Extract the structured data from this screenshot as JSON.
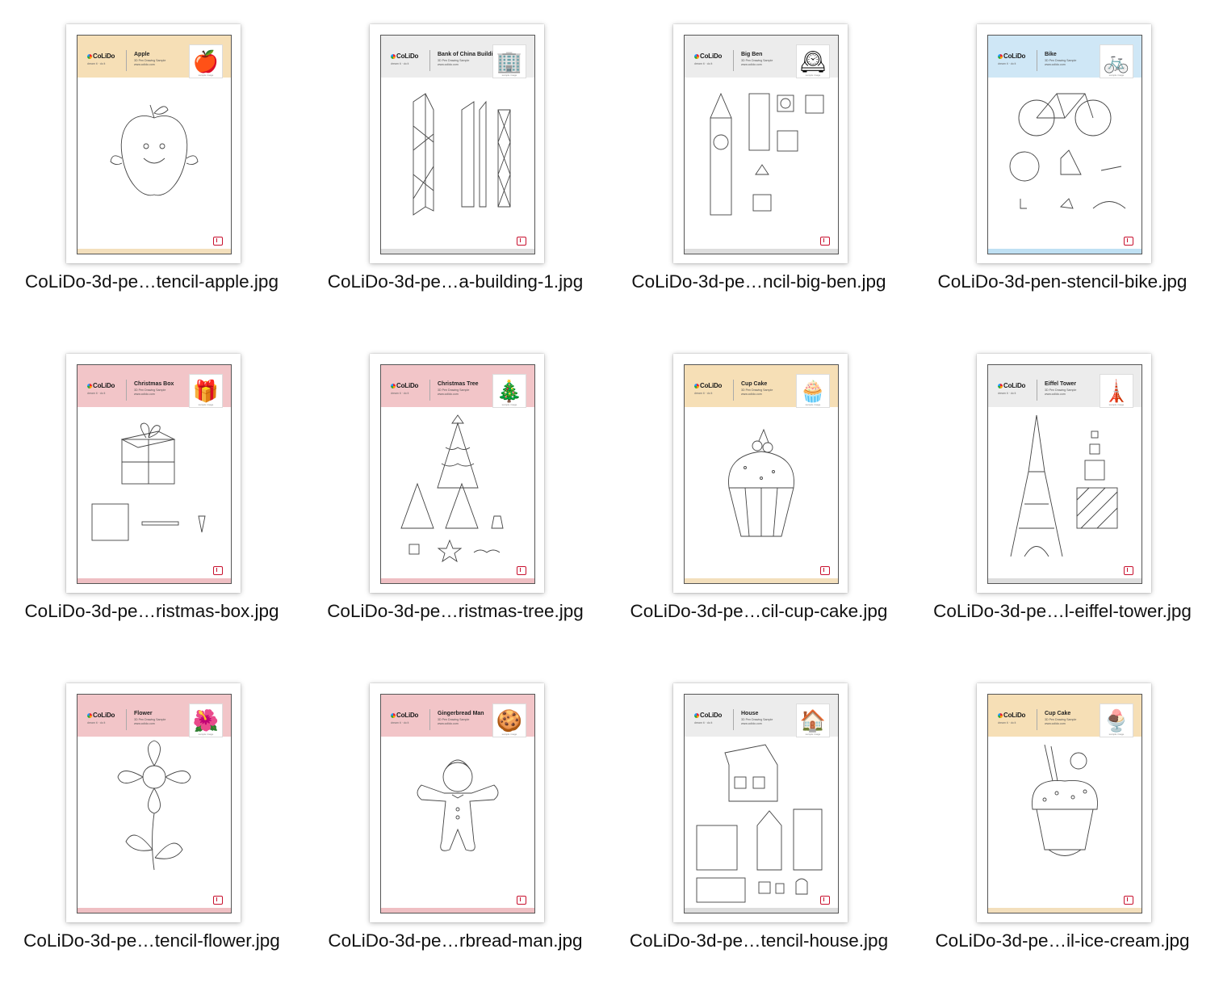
{
  "files": [
    {
      "filename": "CoLiDo-3d-pe…tencil-apple.jpg",
      "title": "Apple",
      "subtitle": "3D Pen Drawing Sample",
      "url": "www.colido.com",
      "header_color": "#f6dfb6",
      "footer_color": "#f3dfbc",
      "icon": "apple-icon",
      "glyph": "🍎",
      "sketch": "apple"
    },
    {
      "filename": "CoLiDo-3d-pe…a-building-1.jpg",
      "title": "Bank of China Building",
      "subtitle": "3D Pen Drawing Sample",
      "url": "www.colido.com",
      "header_color": "#ececec",
      "footer_color": "#dddddd",
      "icon": "skyscraper-icon",
      "glyph": "🏢",
      "sketch": "tower"
    },
    {
      "filename": "CoLiDo-3d-pe…ncil-big-ben.jpg",
      "title": "Big Ben",
      "subtitle": "3D Pen Drawing Sample",
      "url": "www.colido.com",
      "header_color": "#ececec",
      "footer_color": "#dddddd",
      "icon": "clock-tower-icon",
      "glyph": "🕰",
      "sketch": "bigben"
    },
    {
      "filename": "CoLiDo-3d-pen-stencil-bike.jpg",
      "title": "Bike",
      "subtitle": "3D Pen Drawing Sample",
      "url": "www.colido.com",
      "header_color": "#cfe7f6",
      "footer_color": "#bfe0f3",
      "icon": "bicycle-icon",
      "glyph": "🚲",
      "sketch": "bike"
    },
    {
      "filename": "CoLiDo-3d-pe…ristmas-box.jpg",
      "title": "Christmas Box",
      "subtitle": "3D Pen Drawing Sample",
      "url": "www.colido.com",
      "header_color": "#f2c5c8",
      "footer_color": "#efbfc3",
      "icon": "gift-box-icon",
      "glyph": "🎁",
      "sketch": "box"
    },
    {
      "filename": "CoLiDo-3d-pe…ristmas-tree.jpg",
      "title": "Christmas Tree",
      "subtitle": "3D Pen Drawing Sample",
      "url": "www.colido.com",
      "header_color": "#f2c5c8",
      "footer_color": "#efbfc3",
      "icon": "christmas-tree-icon",
      "glyph": "🎄",
      "sketch": "tree"
    },
    {
      "filename": "CoLiDo-3d-pe…cil-cup-cake.jpg",
      "title": "Cup Cake",
      "subtitle": "3D Pen Drawing Sample",
      "url": "www.colido.com",
      "header_color": "#f6dfb6",
      "footer_color": "#f3dfbc",
      "icon": "cupcake-icon",
      "glyph": "🧁",
      "sketch": "cupcake"
    },
    {
      "filename": "CoLiDo-3d-pe…l-eiffel-tower.jpg",
      "title": "Eiffel Tower",
      "subtitle": "3D Pen Drawing Sample",
      "url": "www.colido.com",
      "header_color": "#ececec",
      "footer_color": "#dddddd",
      "icon": "eiffel-tower-icon",
      "glyph": "🗼",
      "sketch": "eiffel"
    },
    {
      "filename": "CoLiDo-3d-pe…tencil-flower.jpg",
      "title": "Flower",
      "subtitle": "3D Pen Drawing Sample",
      "url": "www.colido.com",
      "header_color": "#f2c5c8",
      "footer_color": "#efbfc3",
      "icon": "flower-icon",
      "glyph": "🌺",
      "sketch": "flower"
    },
    {
      "filename": "CoLiDo-3d-pe…rbread-man.jpg",
      "title": "Gingerbread Man",
      "subtitle": "3D Pen Drawing Sample",
      "url": "www.colido.com",
      "header_color": "#f2c5c8",
      "footer_color": "#efbfc3",
      "icon": "gingerbread-man-icon",
      "glyph": "🍪",
      "sketch": "ginger"
    },
    {
      "filename": "CoLiDo-3d-pe…tencil-house.jpg",
      "title": "House",
      "subtitle": "3D Pen Drawing Sample",
      "url": "www.colido.com",
      "header_color": "#ececec",
      "footer_color": "#dddddd",
      "icon": "house-icon",
      "glyph": "🏠",
      "sketch": "house"
    },
    {
      "filename": "CoLiDo-3d-pe…il-ice-cream.jpg",
      "title": "Cup Cake",
      "subtitle": "3D Pen Drawing Sample",
      "url": "www.colido.com",
      "header_color": "#f6dfb6",
      "footer_color": "#f3dfbc",
      "icon": "ice-cream-cupcake-icon",
      "glyph": "🍨",
      "sketch": "icecream"
    }
  ],
  "logo_text": "CoLiDo",
  "tagline": "dream it · do it",
  "sample_label": "sample image"
}
